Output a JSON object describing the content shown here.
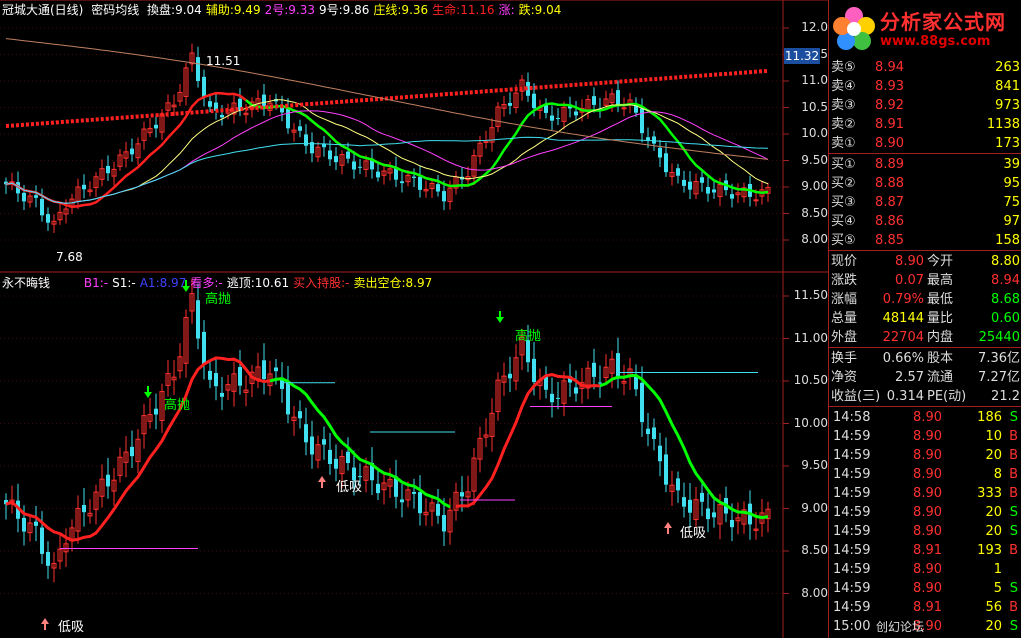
{
  "top_header": {
    "title": "冠城大通(日线)",
    "name": "密码均线",
    "items": [
      {
        "label": "換盘:9.04",
        "color": "#ffffff"
      },
      {
        "label": "辅助:9.49",
        "color": "#ffff00"
      },
      {
        "label": "2号:9.33",
        "color": "#ff40ff"
      },
      {
        "label": "9号:9.86",
        "color": "#ffffff"
      },
      {
        "label": "庄线:9.36",
        "color": "#ffff00"
      },
      {
        "label": "生命:11.16",
        "color": "#ff2020"
      },
      {
        "label": "涨:",
        "color": "#ff40ff"
      },
      {
        "label": "跌:9.04",
        "color": "#ffff00"
      }
    ]
  },
  "bottom_header": {
    "title": "永不晦钱",
    "items": [
      {
        "label": "B1:-",
        "color": "#ff40ff"
      },
      {
        "label": "S1:-",
        "color": "#ffffff"
      },
      {
        "label": "A1:8.97",
        "color": "#4040ff"
      },
      {
        "label": "看多:-",
        "color": "#ff40ff"
      },
      {
        "label": "逃顶:10.61",
        "color": "#ffffff"
      },
      {
        "label": "买入持股:-",
        "color": "#ff3030"
      },
      {
        "label": "卖出空仓:8.97",
        "color": "#ffff00"
      }
    ]
  },
  "top_axis": [
    "12.0",
    "11.5",
    "11.0",
    "10.5",
    "10.0",
    "9.50",
    "9.00",
    "8.50",
    "8.00"
  ],
  "bottom_axis": [
    "11.50",
    "11.00",
    "10.50",
    "10.00",
    "9.50",
    "9.00",
    "8.50",
    "8.00"
  ],
  "current_price_tag": "11.32",
  "top_annotations": {
    "high": "11.51",
    "low": "7.68"
  },
  "signals": {
    "high_throw": "高抛",
    "low_buy": "低吸"
  },
  "logo": {
    "title": "分析家公式网",
    "url": "www.88gs.com"
  },
  "order_book": {
    "sells": [
      {
        "label": "卖⑤",
        "price": "8.94",
        "vol": "263"
      },
      {
        "label": "卖④",
        "price": "8.93",
        "vol": "841"
      },
      {
        "label": "卖③",
        "price": "8.92",
        "vol": "973"
      },
      {
        "label": "卖②",
        "price": "8.91",
        "vol": "1138"
      },
      {
        "label": "卖①",
        "price": "8.90",
        "vol": "173"
      }
    ],
    "buys": [
      {
        "label": "买①",
        "price": "8.89",
        "vol": "39"
      },
      {
        "label": "买②",
        "price": "8.88",
        "vol": "95"
      },
      {
        "label": "买③",
        "price": "8.87",
        "vol": "75"
      },
      {
        "label": "买④",
        "price": "8.86",
        "vol": "97"
      },
      {
        "label": "买⑤",
        "price": "8.85",
        "vol": "158"
      }
    ]
  },
  "quote": [
    {
      "l1": "现价",
      "v1": "8.90",
      "c1": "#ff3030",
      "l2": "今开",
      "v2": "8.80",
      "c2": "#ffff00"
    },
    {
      "l1": "涨跌",
      "v1": "0.07",
      "c1": "#ff3030",
      "l2": "最高",
      "v2": "8.94",
      "c2": "#ff3030"
    },
    {
      "l1": "涨幅",
      "v1": "0.79%",
      "c1": "#ff3030",
      "l2": "最低",
      "v2": "8.68",
      "c2": "#00ff00"
    },
    {
      "l1": "总量",
      "v1": "48144",
      "c1": "#ffff00",
      "l2": "量比",
      "v2": "0.60",
      "c2": "#00ff00"
    },
    {
      "l1": "外盘",
      "v1": "22704",
      "c1": "#ff3030",
      "l2": "内盘",
      "v2": "25440",
      "c2": "#00ff00"
    }
  ],
  "fundamentals": [
    {
      "l1": "换手",
      "v1": "0.66%",
      "l2": "股本",
      "v2": "7.36亿"
    },
    {
      "l1": "净资",
      "v1": "2.57",
      "l2": "流通",
      "v2": "7.27亿"
    },
    {
      "l1": "收益(三)",
      "v1": "0.314",
      "l2": "PE(动)",
      "v2": "21.2"
    }
  ],
  "ticks": [
    {
      "time": "14:58",
      "price": "8.90",
      "vol": "186",
      "side": "S"
    },
    {
      "time": "14:59",
      "price": "8.90",
      "vol": "10",
      "side": "B"
    },
    {
      "time": "14:59",
      "price": "8.90",
      "vol": "20",
      "side": "B"
    },
    {
      "time": "14:59",
      "price": "8.90",
      "vol": "8",
      "side": "B"
    },
    {
      "time": "14:59",
      "price": "8.90",
      "vol": "333",
      "side": "B"
    },
    {
      "time": "14:59",
      "price": "8.90",
      "vol": "20",
      "side": "S"
    },
    {
      "time": "14:59",
      "price": "8.90",
      "vol": "20",
      "side": "S"
    },
    {
      "time": "14:59",
      "price": "8.91",
      "vol": "193",
      "side": "B"
    },
    {
      "time": "14:59",
      "price": "8.90",
      "vol": "1",
      "side": ""
    },
    {
      "time": "14:59",
      "price": "8.90",
      "vol": "5",
      "side": "S"
    },
    {
      "time": "14:59",
      "price": "8.91",
      "vol": "56",
      "side": "B"
    },
    {
      "time": "15:00",
      "price": "8.90",
      "vol": "20",
      "side": "S"
    }
  ],
  "watermark": "创幻论坛"
}
